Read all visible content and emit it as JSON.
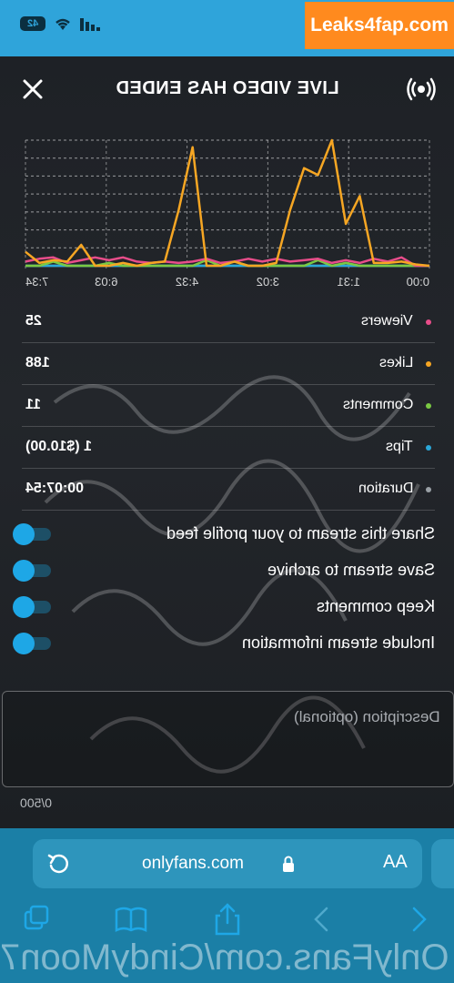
{
  "status_bar": {
    "battery": "42"
  },
  "watermark_top": "Leaks4fap.com",
  "header": {
    "title": "LIVE VIDEO HAS ENDED"
  },
  "chart_data": {
    "type": "line",
    "x": [
      "0:00",
      "1:31",
      "3:02",
      "4:32",
      "6:03",
      "7:34"
    ],
    "series": [
      {
        "color": "#f6a623",
        "values": [
          0,
          0.1,
          0.3,
          0.2,
          0.2,
          5,
          3,
          9,
          6.5,
          7,
          4,
          0.2,
          0,
          0,
          0.3,
          0,
          0,
          8.5,
          4,
          0.3,
          0.2,
          0,
          0.2,
          0,
          0,
          1.5,
          0.3,
          0.4,
          0.2,
          1
        ]
      },
      {
        "color": "#e84d8a",
        "values": [
          0,
          0,
          0.6,
          0.3,
          0.5,
          0.2,
          0.4,
          0.2,
          0.5,
          0.4,
          0.3,
          0.5,
          0.3,
          0.5,
          0.3,
          0.2,
          0.5,
          0.3,
          0.2,
          0.3,
          0.2,
          0.3,
          0.6,
          0.4,
          0.6,
          0.4,
          0.2,
          0.6,
          0.5,
          0.3
        ]
      },
      {
        "color": "#7ac943",
        "values": [
          0,
          0,
          0,
          0,
          0,
          0,
          0.2,
          0,
          0.4,
          0,
          0,
          0,
          0,
          0,
          0.3,
          0,
          0.4,
          0,
          0,
          0,
          0,
          0,
          0,
          0.2,
          0,
          0,
          0,
          0.3,
          0,
          0
        ]
      },
      {
        "color": "#2aa7d8",
        "values": [
          0,
          0,
          0,
          0,
          0,
          0,
          0,
          0,
          0,
          0,
          0,
          0,
          0,
          0,
          0,
          0,
          0,
          0,
          0,
          0,
          0,
          0,
          0,
          0,
          0,
          0,
          0,
          0,
          0,
          0
        ]
      },
      {
        "color": "#9aa0a6",
        "values": [
          0,
          0,
          0,
          0,
          0,
          0,
          0,
          0,
          0,
          0,
          0,
          0,
          0,
          0,
          0,
          0,
          0,
          0,
          0,
          0,
          0,
          0,
          0,
          0,
          0,
          0,
          0,
          0,
          0,
          0
        ]
      }
    ],
    "ylim": [
      0,
      9
    ],
    "grid": true
  },
  "stats": [
    {
      "label": "Viewers",
      "value": "25",
      "color": "#e84d8a"
    },
    {
      "label": "Likes",
      "value": "188",
      "color": "#f6a623"
    },
    {
      "label": "Comments",
      "value": "11",
      "color": "#7ac943"
    },
    {
      "label": "Tips",
      "value": "1 ($10.00)",
      "color": "#2aa7d8"
    },
    {
      "label": "Duration",
      "value": "00:07:54",
      "color": "#9aa0a6"
    }
  ],
  "toggles": [
    {
      "label": "Share this stream to your profile feed",
      "on": true
    },
    {
      "label": "Save stream to archive",
      "on": true
    },
    {
      "label": "Keep comments",
      "on": true
    },
    {
      "label": "Include stream information",
      "on": true
    }
  ],
  "description": {
    "placeholder": "Description (optional)",
    "counter": "0/500"
  },
  "browser": {
    "url": "onlyfans.com",
    "aa": "AA"
  },
  "watermark_bottom": "OnlyFans.com/CindyMoon7"
}
